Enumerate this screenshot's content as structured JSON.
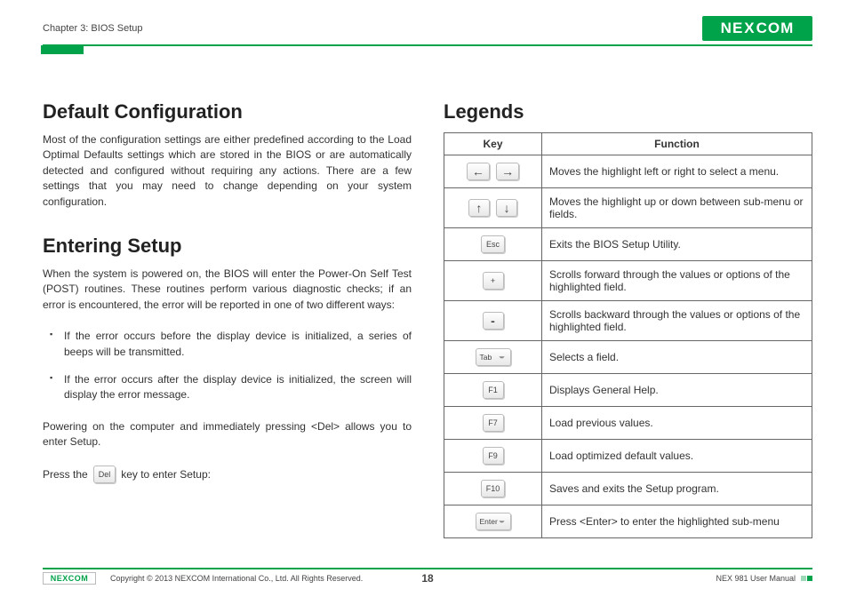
{
  "header": {
    "chapter": "Chapter 3: BIOS Setup",
    "logo": "NEXCOM"
  },
  "left": {
    "h1": "Default Configuration",
    "p1": "Most of the configuration settings are either predefined according to the Load Optimal Defaults settings which are stored in the BIOS or are automatically detected and configured without requiring any actions. There are a few settings that you may need to change depending on your system configuration.",
    "h2": "Entering Setup",
    "p2": "When the system is powered on, the BIOS will enter the Power-On Self Test (POST) routines. These routines perform various diagnostic checks; if an error is encountered, the error will be reported in one of two different ways:",
    "b1": "If the error occurs before the display device is initialized, a series of beeps will be transmitted.",
    "b2": "If the error occurs after the display device is initialized, the screen will display the error message.",
    "p3": "Powering on the computer and immediately pressing <Del> allows you to enter Setup.",
    "p4a": "Press the",
    "p4key": "Del",
    "p4b": "key to enter Setup:"
  },
  "right": {
    "h1": "Legends",
    "th_key": "Key",
    "th_func": "Function",
    "rows": [
      {
        "keys": [
          "←",
          "→"
        ],
        "func": "Moves the highlight left or right to select a menu."
      },
      {
        "keys": [
          "↑",
          "↓"
        ],
        "func": "Moves the highlight up or down between sub-menu or fields."
      },
      {
        "keys": [
          "Esc"
        ],
        "func": "Exits the BIOS Setup Utility."
      },
      {
        "keys": [
          "+"
        ],
        "func": "Scrolls forward through the values or options of the highlighted field."
      },
      {
        "keys": [
          "-"
        ],
        "func": "Scrolls backward through the values or options of the highlighted field."
      },
      {
        "keys": [
          "Tab"
        ],
        "wide": true,
        "func": "Selects a field."
      },
      {
        "keys": [
          "F1"
        ],
        "func": "Displays General Help."
      },
      {
        "keys": [
          "F7"
        ],
        "func": "Load previous values."
      },
      {
        "keys": [
          "F9"
        ],
        "func": "Load optimized default values."
      },
      {
        "keys": [
          "F10"
        ],
        "func": "Saves and exits the Setup program."
      },
      {
        "keys": [
          "Enter"
        ],
        "wide": true,
        "func": "Press <Enter> to enter the highlighted sub-menu"
      }
    ]
  },
  "footer": {
    "logo": "NEXCOM",
    "copyright": "Copyright © 2013 NEXCOM International Co., Ltd. All Rights Reserved.",
    "page": "18",
    "manual": "NEX 981 User Manual"
  }
}
